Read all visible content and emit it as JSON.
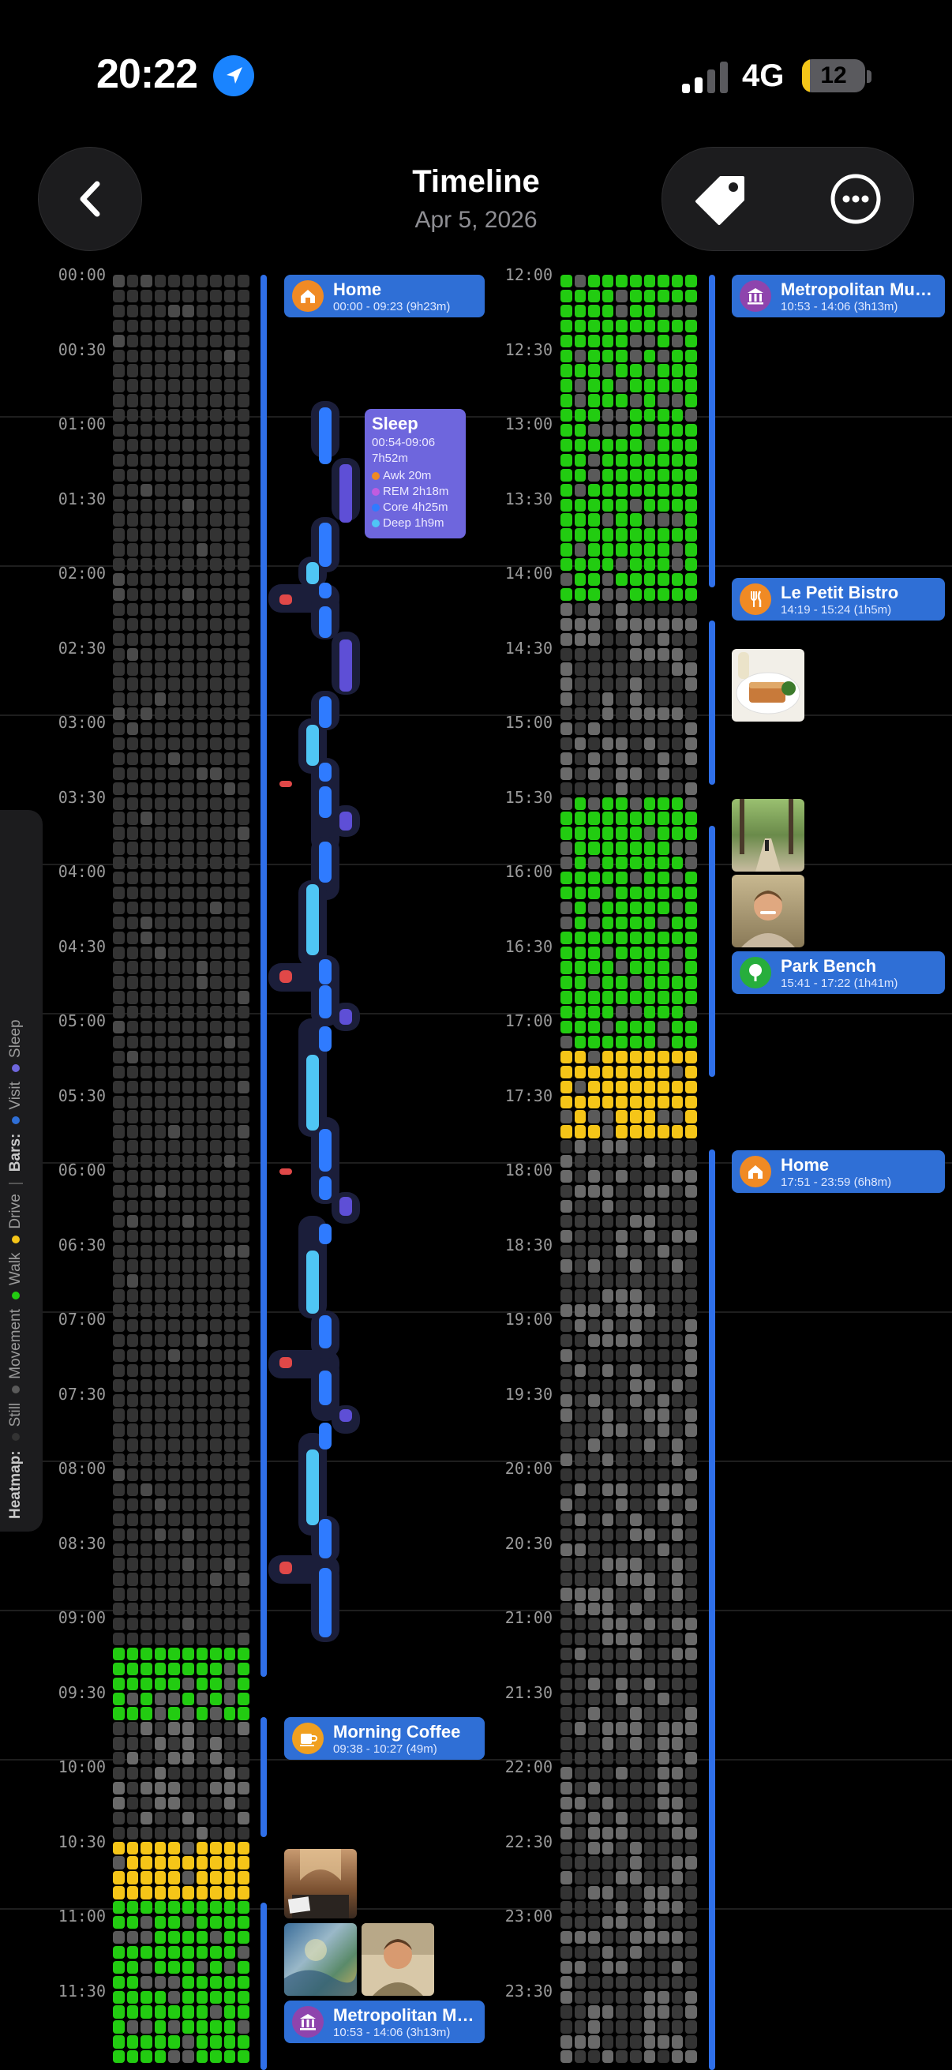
{
  "status_bar": {
    "time": "20:22",
    "network": "4G",
    "battery_level": "12",
    "battery_fraction": 0.12
  },
  "header": {
    "title": "Timeline",
    "date": "Apr 5, 2026"
  },
  "colors": {
    "still": "#333333",
    "movement": "#5a5a5a",
    "walk": "#22cc11",
    "drive": "#f5c518",
    "visit": "#2f6fd6",
    "sleep": "#6e66dd"
  },
  "hours_left": [
    "00:00",
    "00:30",
    "01:00",
    "01:30",
    "02:00",
    "02:30",
    "03:00",
    "03:30",
    "04:00",
    "04:30",
    "05:00",
    "05:30",
    "06:00",
    "06:30",
    "07:00",
    "07:30",
    "08:00",
    "08:30",
    "09:00",
    "09:30",
    "10:00",
    "10:30",
    "11:00",
    "11:30"
  ],
  "hours_right": [
    "12:00",
    "12:30",
    "13:00",
    "13:30",
    "14:00",
    "14:30",
    "15:00",
    "15:30",
    "16:00",
    "16:30",
    "17:00",
    "17:30",
    "18:00",
    "18:30",
    "19:00",
    "19:30",
    "20:00",
    "20:30",
    "21:00",
    "21:30",
    "22:00",
    "22:30",
    "23:00",
    "23:30"
  ],
  "heatmap": {
    "left": [
      {
        "from": "00:00",
        "to": "09:15",
        "state": "still"
      },
      {
        "from": "09:15",
        "to": "09:45",
        "state": "walk"
      },
      {
        "from": "09:45",
        "to": "10:30",
        "state": "movement"
      },
      {
        "from": "10:30",
        "to": "10:55",
        "state": "drive"
      },
      {
        "from": "10:55",
        "to": "12:00",
        "state": "walk"
      }
    ],
    "right": [
      {
        "from": "12:00",
        "to": "14:15",
        "state": "walk"
      },
      {
        "from": "14:15",
        "to": "15:30",
        "state": "movement"
      },
      {
        "from": "15:30",
        "to": "17:15",
        "state": "walk"
      },
      {
        "from": "17:15",
        "to": "17:50",
        "state": "drive"
      },
      {
        "from": "17:50",
        "to": "24:00",
        "state": "movement"
      }
    ]
  },
  "visits": [
    {
      "name": "Home",
      "time": "00:00 - 09:23 (9h23m)",
      "icon": "house-icon",
      "icon_color": "#f08a24"
    },
    {
      "name": "Morning Coffee",
      "time": "09:38 - 10:27 (49m)",
      "icon": "coffee-icon",
      "icon_color": "#f0a020"
    },
    {
      "name": "Metropolitan Museum of Art",
      "time": "10:53 - 14:06 (3h13m)",
      "icon": "museum-icon",
      "icon_color": "#8e44ad"
    },
    {
      "name": "Metropolitan Museum of Art",
      "time": "10:53 - 14:06 (3h13m)",
      "icon": "museum-icon",
      "icon_color": "#8e44ad"
    },
    {
      "name": "Le Petit Bistro",
      "time": "14:19 - 15:24 (1h5m)",
      "icon": "fork-knife-icon",
      "icon_color": "#f08a24"
    },
    {
      "name": "Park Bench",
      "time": "15:41 - 17:22 (1h41m)",
      "icon": "tree-icon",
      "icon_color": "#27ae3c"
    },
    {
      "name": "Home",
      "time": "17:51 - 23:59 (6h8m)",
      "icon": "house-icon",
      "icon_color": "#f08a24"
    }
  ],
  "sleep": {
    "title": "Sleep",
    "range": "00:54-09:06",
    "duration": "7h52m",
    "stages": [
      {
        "label": "Awk 20m",
        "color": "#f08a24"
      },
      {
        "label": "REM 2h18m",
        "color": "#c05ce0"
      },
      {
        "label": "Core 4h25m",
        "color": "#2f7bff"
      },
      {
        "label": "Deep 1h9m",
        "color": "#4fc6f5"
      }
    ]
  },
  "legend": {
    "heatmap_label": "Heatmap:",
    "bars_label": "Bars:",
    "items": [
      "Still",
      "Movement",
      "Walk",
      "Drive",
      "Visit",
      "Sleep"
    ]
  },
  "icons": [
    "location-arrow-icon",
    "back-chevron-icon",
    "tag-icon",
    "more-icon"
  ]
}
